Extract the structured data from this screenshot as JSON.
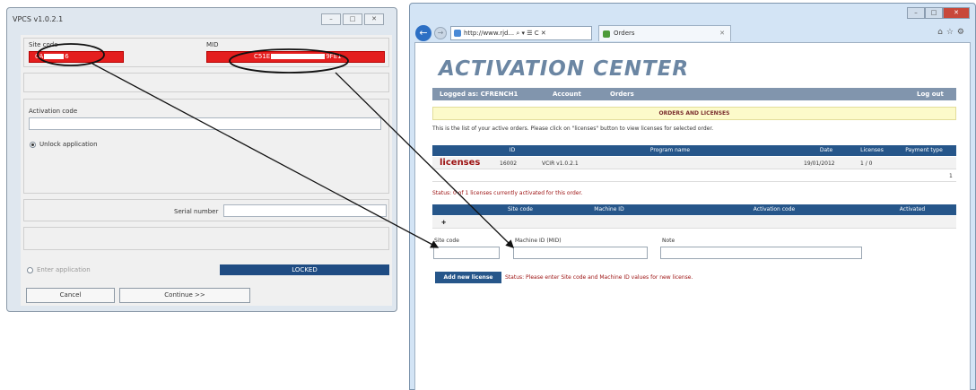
{
  "app": {
    "title": "VPCS v1.0.2.1",
    "site_code_label": "Site code",
    "site_code_value_start": "0A",
    "site_code_value_end": "6",
    "mid_label": "MID",
    "mid_value_start": "C51E",
    "mid_value_end": "9FE1",
    "activation_code_label": "Activation code",
    "unlock_option": "Unlock application",
    "serial_label": "Serial number",
    "enter_option": "Enter application",
    "locked_status": "LOCKED",
    "cancel_button": "Cancel",
    "continue_button": "Continue >>"
  },
  "browser": {
    "address": "http://www.rjd...",
    "address_tools": "⌕ ▾ ☰ C ✕",
    "tab_title": "Orders",
    "tab_close": "✕"
  },
  "page": {
    "title": "ACTIVATION CENTER",
    "menu": {
      "logged": "Logged as: CFRENCH1",
      "account": "Account",
      "orders": "Orders",
      "logout": "Log out"
    },
    "section_title": "ORDERS AND LICENSES",
    "info_text": "This is the list of your active orders. Please click on \"licenses\" button to view licenses for selected order.",
    "orders_table": {
      "headers": [
        "ID",
        "Program name",
        "Date",
        "Licenses",
        "Payment type"
      ],
      "row": {
        "action": "licenses",
        "id": "16002",
        "program": "VCIR v1.0.2.1",
        "date": "19/01/2012",
        "licenses": "1 / 0",
        "payment": ""
      },
      "pager": "1"
    },
    "status_line": "Status: 0 of 1 licenses currently activated for this order.",
    "licenses_table": {
      "headers": [
        "Site code",
        "Machine ID",
        "Activation code",
        "Activated"
      ]
    },
    "form": {
      "site_code_label": "Site code",
      "machine_id_label": "Machine ID (MID)",
      "note_label": "Note"
    },
    "add_button": "Add new license",
    "form_status": "Status: Please enter Site code and Machine ID values for new license."
  }
}
